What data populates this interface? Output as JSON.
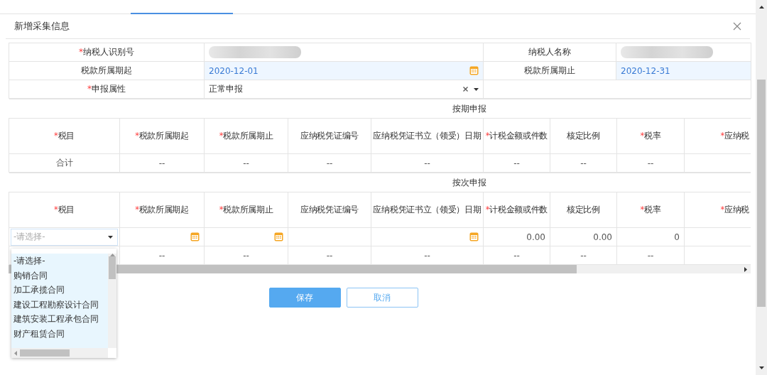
{
  "dialog": {
    "title": "新增采集信息"
  },
  "form": [
    {
      "label": "纳税人识别号",
      "mark": "*",
      "kind": "redacted"
    },
    {
      "label": "纳税人名称",
      "kind": "redacted"
    },
    {
      "label": "税款所属期起",
      "kind": "date",
      "value": "2020-12-01",
      "calendar": true
    },
    {
      "label": "税款所属期止",
      "kind": "date",
      "value": "2020-12-31",
      "calendar": false
    },
    {
      "label": "申报属性",
      "mark": "*",
      "kind": "select",
      "value": "正常申报"
    }
  ],
  "sections": [
    {
      "title": "按期申报",
      "columns": [
        {
          "label": "税目",
          "mark": "*"
        },
        {
          "label": "税款所属期起",
          "mark": "*"
        },
        {
          "label": "税款所属期止",
          "mark": "*"
        },
        {
          "label": "应纳税凭证编号"
        },
        {
          "label": "应纳税凭证书立（领受）日期"
        },
        {
          "label": "计税金额或件数",
          "mark": "*"
        },
        {
          "label": "核定比例"
        },
        {
          "label": "税率",
          "mark": "*"
        },
        {
          "label": "应纳税",
          "mark": "*"
        }
      ],
      "rows": [
        [
          {
            "kind": "text",
            "text": "合计"
          },
          {
            "kind": "text",
            "text": "--"
          },
          {
            "kind": "text",
            "text": "--"
          },
          {
            "kind": "text",
            "text": "--"
          },
          {
            "kind": "text",
            "text": "--"
          },
          {
            "kind": "text",
            "text": "--"
          },
          {
            "kind": "text",
            "text": "--"
          },
          {
            "kind": "text",
            "text": "--"
          },
          {
            "kind": "empty"
          }
        ]
      ]
    },
    {
      "title": "按次申报",
      "columns": [
        {
          "label": "税目",
          "mark": "*"
        },
        {
          "label": "税款所属期起",
          "mark": "*"
        },
        {
          "label": "税款所属期止",
          "mark": "*"
        },
        {
          "label": "应纳税凭证编号"
        },
        {
          "label": "应纳税凭证书立（领受）日期"
        },
        {
          "label": "计税金额或件数",
          "mark": "*"
        },
        {
          "label": "核定比例"
        },
        {
          "label": "税率",
          "mark": "*"
        },
        {
          "label": "应纳税",
          "mark": "*"
        }
      ],
      "rows": [
        [
          {
            "kind": "select",
            "placeholder": "-请选择-"
          },
          {
            "kind": "date"
          },
          {
            "kind": "date"
          },
          {
            "kind": "input"
          },
          {
            "kind": "date"
          },
          {
            "kind": "number",
            "value": "0.00"
          },
          {
            "kind": "number",
            "value": "0.00"
          },
          {
            "kind": "number",
            "value": "0"
          },
          {
            "kind": "empty"
          }
        ],
        [
          {
            "kind": "empty"
          },
          {
            "kind": "text",
            "text": "--"
          },
          {
            "kind": "text",
            "text": "--"
          },
          {
            "kind": "text",
            "text": "--"
          },
          {
            "kind": "text",
            "text": "--"
          },
          {
            "kind": "text",
            "text": "--"
          },
          {
            "kind": "text",
            "text": "--"
          },
          {
            "kind": "text",
            "text": "--"
          },
          {
            "kind": "empty"
          }
        ]
      ]
    }
  ],
  "dropdown": {
    "items": [
      "-请选择-",
      "购销合同",
      "加工承揽合同",
      "建设工程勘察设计合同",
      "建筑安装工程承包合同",
      "财产租赁合同"
    ]
  },
  "buttons": [
    {
      "label": "保存",
      "kind": "primary"
    },
    {
      "label": "取消",
      "kind": "secondary"
    }
  ]
}
